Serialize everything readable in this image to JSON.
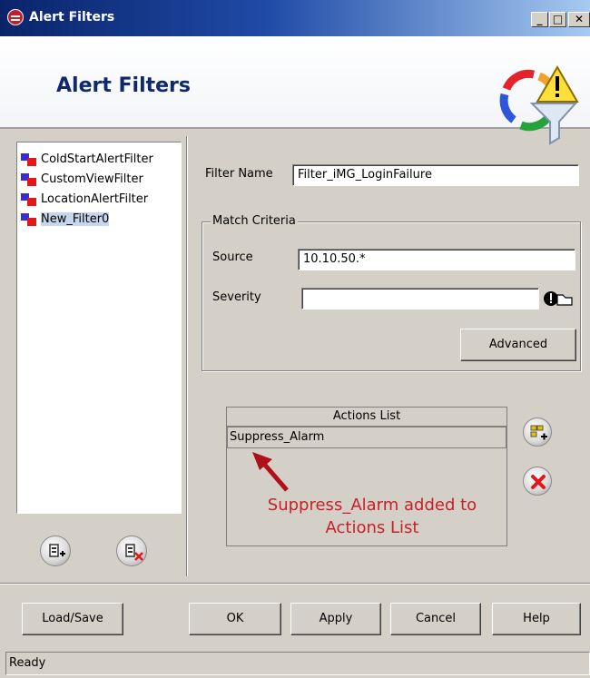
{
  "window": {
    "title": "Alert Filters"
  },
  "header": {
    "title": "Alert Filters"
  },
  "filters": [
    {
      "label": "ColdStartAlertFilter",
      "selected": false
    },
    {
      "label": "CustomViewFilter",
      "selected": false
    },
    {
      "label": "LocationAlertFilter",
      "selected": false
    },
    {
      "label": "New_Filter0",
      "selected": true
    }
  ],
  "form": {
    "filter_name_label": "Filter Name",
    "filter_name_value": "Filter_iMG_LoginFailure",
    "match_criteria_legend": "Match Criteria",
    "source_label": "Source",
    "source_value": "10.10.50.*",
    "severity_label": "Severity",
    "severity_value": "",
    "advanced_label": "Advanced"
  },
  "actions": {
    "header": "Actions List",
    "items": [
      "Suppress_Alarm"
    ],
    "annotation_line1": "Suppress_Alarm added to",
    "annotation_line2": "Actions List"
  },
  "buttons": {
    "load_save": "Load/Save",
    "ok": "OK",
    "apply": "Apply",
    "cancel": "Cancel",
    "help": "Help"
  },
  "status": {
    "text": "Ready"
  },
  "colors": {
    "title_blue": "#0a246a",
    "selection": "#c6d6ec",
    "annotation_red": "#c8202a"
  },
  "icons": [
    "app-icon",
    "alert-funnel-icon",
    "add-filter-icon",
    "delete-filter-icon",
    "add-action-icon",
    "remove-action-icon",
    "severity-picker-icon"
  ]
}
